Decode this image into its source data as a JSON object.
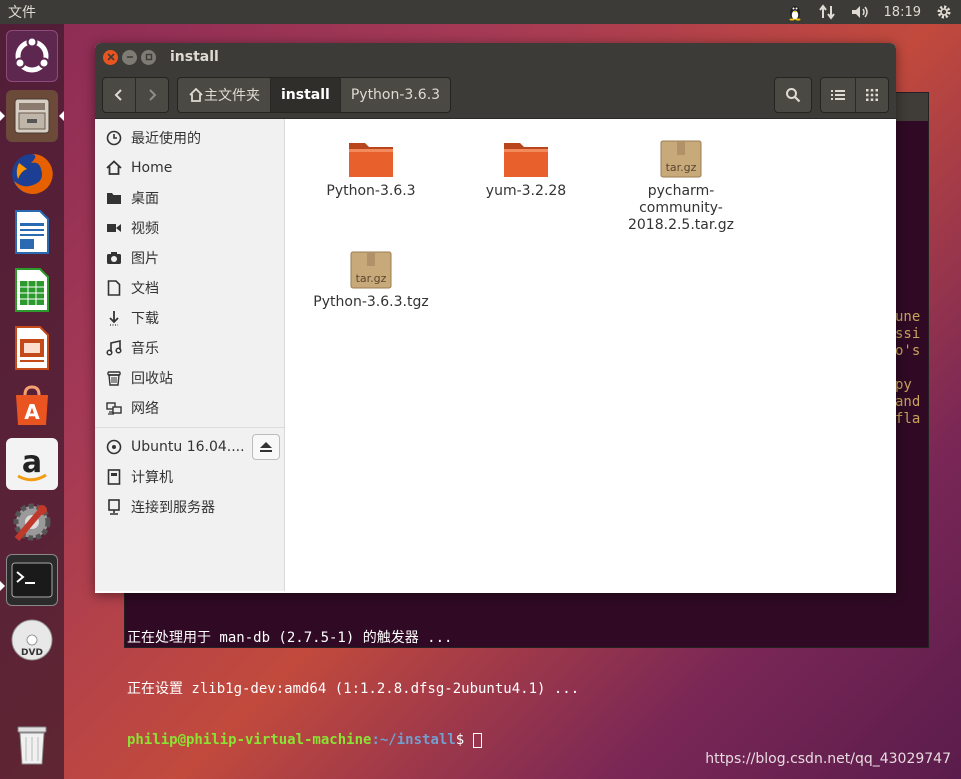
{
  "top_panel": {
    "app_menu": "文件",
    "clock": "18:19",
    "icons": [
      "tux-icon",
      "network-arrows-icon",
      "volume-icon",
      "gear-icon"
    ]
  },
  "launcher": {
    "items": [
      "ubuntu-dash-icon",
      "files-icon",
      "firefox-icon",
      "writer-icon",
      "calc-icon",
      "impress-icon",
      "software-center-icon",
      "amazon-icon",
      "system-settings-icon",
      "terminal-icon",
      "dvd-icon",
      "trash-icon"
    ]
  },
  "window": {
    "title": "install",
    "colors": {
      "accent": "#e95420",
      "folder": "#e8602c",
      "header": "#3c3b37"
    }
  },
  "toolbar": {
    "back_label": "‹",
    "forward_label": "›",
    "breadcrumbs": [
      "主文件夹",
      "install",
      "Python-3.6.3"
    ]
  },
  "sidebar": {
    "places": [
      {
        "label": "最近使用的",
        "icon": "clock-icon"
      },
      {
        "label": "Home",
        "icon": "home-icon"
      },
      {
        "label": "桌面",
        "icon": "folder-icon"
      },
      {
        "label": "视频",
        "icon": "video-icon"
      },
      {
        "label": "图片",
        "icon": "camera-icon"
      },
      {
        "label": "文档",
        "icon": "document-icon"
      },
      {
        "label": "下载",
        "icon": "download-icon"
      },
      {
        "label": "音乐",
        "icon": "music-icon"
      },
      {
        "label": "回收站",
        "icon": "trash-icon"
      },
      {
        "label": "网络",
        "icon": "network-icon"
      }
    ],
    "devices": [
      {
        "label": "Ubuntu 16.04....",
        "icon": "disc-icon"
      },
      {
        "label": "计算机",
        "icon": "computer-icon"
      },
      {
        "label": "连接到服务器",
        "icon": "server-icon"
      }
    ]
  },
  "files": [
    {
      "name": "Python-3.6.3",
      "type": "folder"
    },
    {
      "name": "yum-3.2.28",
      "type": "folder"
    },
    {
      "name_lines": [
        "pycharm-",
        "community-",
        "2018.2.5.tar.gz"
      ],
      "type": "archive",
      "badge": "tar.gz"
    },
    {
      "name": "Python-3.6.3.tgz",
      "type": "archive",
      "badge": "tar.gz"
    }
  ],
  "terminal": {
    "line1": "正在处理用于 man-db (2.7.5-1) 的触发器 ...",
    "line2": "正在设置 zlib1g-dev:amd64 (1:1.2.8.dfsg-2ubuntu4.1) ...",
    "prompt_user": "philip@philip-virtual-machine",
    "prompt_path": ":~/install",
    "prompt_suffix": "$ ",
    "side_fragments": [
      "une",
      "ssi",
      "o's",
      "",
      "py",
      "and",
      "fla"
    ]
  },
  "watermark": "https://blog.csdn.net/qq_43029747"
}
